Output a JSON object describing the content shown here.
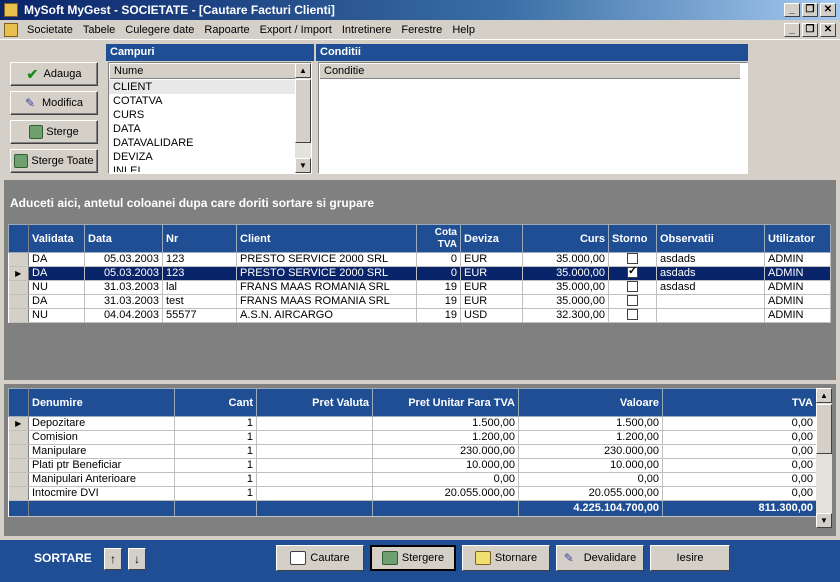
{
  "window": {
    "app_title": "MySoft MyGest  - SOCIETATE - [Cautare Facturi Clienti]",
    "controls": [
      "_",
      "❐",
      "✕"
    ]
  },
  "menu": {
    "items": [
      "Societate",
      "Tabele",
      "Culegere date",
      "Rapoarte",
      "Export / Import",
      "Intretinere",
      "Ferestre",
      "Help"
    ],
    "controls": [
      "_",
      "❐",
      "✕"
    ]
  },
  "side_buttons": {
    "add": "Adauga",
    "edit": "Modifica",
    "delete": "Sterge",
    "delete_all": "Sterge Toate"
  },
  "campuri": {
    "title": "Campuri",
    "column": "Nume",
    "items": [
      "CLIENT",
      "COTATVA",
      "CURS",
      "DATA",
      "DATAVALIDARE",
      "DEVIZA",
      "INLEI"
    ]
  },
  "conditii": {
    "title": "Conditii",
    "column": "Conditie"
  },
  "group_hint": "Aduceti aici, antetul coloanei dupa care doriti sortare si grupare",
  "invoices": {
    "headers": [
      "Validata",
      "Data",
      "Nr",
      "Client",
      "Cota TVA",
      "Deviza",
      "Curs",
      "Storno",
      "Observatii",
      "Utilizator"
    ],
    "rows": [
      {
        "validata": "DA",
        "data": "05.03.2003",
        "nr": "123",
        "client": "PRESTO SERVICE  2000 SRL",
        "cota": "0",
        "deviza": "EUR",
        "curs": "35.000,00",
        "storno": false,
        "obs": "asdads",
        "user": "ADMIN"
      },
      {
        "validata": "DA",
        "data": "05.03.2003",
        "nr": "123",
        "client": "PRESTO SERVICE  2000 SRL",
        "cota": "0",
        "deviza": "EUR",
        "curs": "35.000,00",
        "storno": true,
        "obs": "asdads",
        "user": "ADMIN"
      },
      {
        "validata": "NU",
        "data": "31.03.2003",
        "nr": "lal",
        "client": "FRANS MAAS ROMANIA SRL",
        "cota": "19",
        "deviza": "EUR",
        "curs": "35.000,00",
        "storno": false,
        "obs": "asdasd",
        "user": "ADMIN"
      },
      {
        "validata": "DA",
        "data": "31.03.2003",
        "nr": "test",
        "client": "FRANS MAAS ROMANIA SRL",
        "cota": "19",
        "deviza": "EUR",
        "curs": "35.000,00",
        "storno": false,
        "obs": "",
        "user": "ADMIN"
      },
      {
        "validata": "NU",
        "data": "04.04.2003",
        "nr": "55577",
        "client": "A.S.N. AIRCARGO",
        "cota": "19",
        "deviza": "USD",
        "curs": "32.300,00",
        "storno": false,
        "obs": "",
        "user": "ADMIN"
      }
    ],
    "selected_row": 1
  },
  "items": {
    "headers": [
      "Denumire",
      "Cant",
      "Pret Valuta",
      "Pret Unitar Fara TVA",
      "Valoare",
      "TVA"
    ],
    "rows": [
      {
        "den": "Depozitare",
        "cant": "1",
        "pv": "",
        "pu": "1.500,00",
        "val": "1.500,00",
        "tva": "0,00"
      },
      {
        "den": "Comision",
        "cant": "1",
        "pv": "",
        "pu": "1.200,00",
        "val": "1.200,00",
        "tva": "0,00"
      },
      {
        "den": "Manipulare",
        "cant": "1",
        "pv": "",
        "pu": "230.000,00",
        "val": "230.000,00",
        "tva": "0,00"
      },
      {
        "den": "Plati ptr Beneficiar",
        "cant": "1",
        "pv": "",
        "pu": "10.000,00",
        "val": "10.000,00",
        "tva": "0,00"
      },
      {
        "den": "Manipulari Anterioare",
        "cant": "1",
        "pv": "",
        "pu": "0,00",
        "val": "0,00",
        "tva": "0,00"
      },
      {
        "den": "Intocmire DVI",
        "cant": "1",
        "pv": "",
        "pu": "20.055.000,00",
        "val": "20.055.000,00",
        "tva": "0,00"
      }
    ],
    "total_valoare": "4.225.104.700,00",
    "total_tva": "811.300,00"
  },
  "bottom": {
    "sort_label": "SORTARE",
    "up": "↑",
    "down": "↓",
    "search": "Cautare",
    "clear": "Stergere",
    "storno": "Stornare",
    "invalidate": "Devalidare",
    "exit": "Iesire"
  },
  "colors": {
    "header_blue": "#1f4e94",
    "selection": "#0a246a",
    "chrome": "#d4d0c8"
  }
}
